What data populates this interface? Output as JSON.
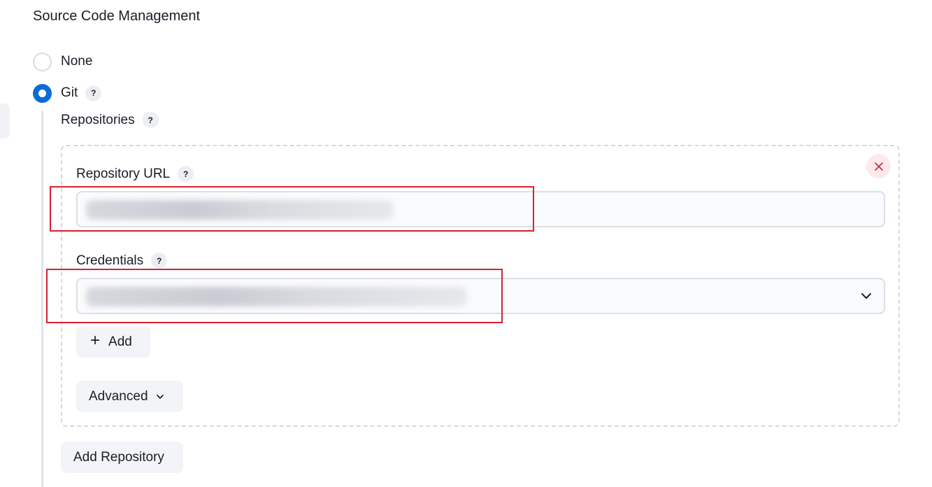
{
  "section": {
    "title": "Source Code Management"
  },
  "scm_options": {
    "none": {
      "label": "None",
      "selected": false
    },
    "git": {
      "label": "Git",
      "selected": true,
      "help": "?"
    }
  },
  "repositories": {
    "label": "Repositories",
    "help": "?",
    "remove_icon": "close-icon",
    "url": {
      "label": "Repository URL",
      "help": "?",
      "value": ""
    },
    "credentials": {
      "label": "Credentials",
      "help": "?",
      "value": ""
    },
    "add_button": {
      "label": "Add",
      "icon": "plus-icon"
    },
    "advanced_button": {
      "label": "Advanced",
      "icon": "chevron-down-icon"
    },
    "add_repository_button": {
      "label": "Add Repository"
    }
  },
  "colors": {
    "accent": "#0b6bd9",
    "danger": "#c8293b",
    "highlight": "#d7212e"
  }
}
